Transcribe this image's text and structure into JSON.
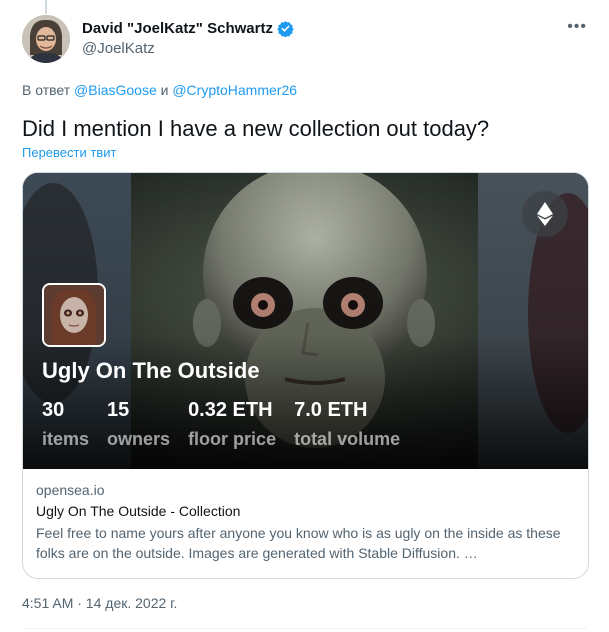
{
  "author": {
    "display_name": "David \"JoelKatz\" Schwartz",
    "handle": "@JoelKatz",
    "verified_icon": "verified-badge-icon",
    "more_icon": "more-icon"
  },
  "reply": {
    "prefix": "В ответ",
    "user1": "@BiasGoose",
    "conj": "и",
    "user2": "@CryptoHammer26"
  },
  "tweet": {
    "text": "Did I mention I have a new collection out today?",
    "translate": "Перевести твит",
    "timestamp": "4:51 AM · 14 дек. 2022 г."
  },
  "card": {
    "collection_name": "Ugly On The Outside",
    "eth_icon": "ethereum-icon",
    "stats": [
      {
        "value": "30",
        "label": "items"
      },
      {
        "value": "15",
        "label": "owners"
      },
      {
        "value": "0.32 ETH",
        "label": "floor price"
      },
      {
        "value": "7.0 ETH",
        "label": "total volume"
      }
    ],
    "domain": "opensea.io",
    "title": "Ugly On The Outside - Collection",
    "description": "Feel free to name yours after anyone you know who is as ugly on the inside as these folks are on the outside. Images are generated with Stable Diffusion. …"
  },
  "colors": {
    "link": "#1d9bf0",
    "secondary_text": "#536471",
    "primary_text": "#0f1419",
    "border": "#cfd9de"
  }
}
